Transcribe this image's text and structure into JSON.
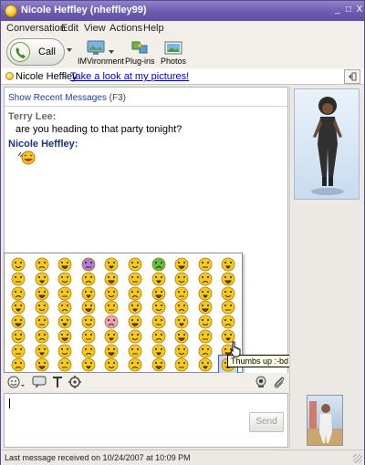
{
  "window": {
    "title": "Nicole Heffley (nheffley99)",
    "controls": [
      "_",
      "□",
      "X"
    ]
  },
  "menu": [
    "Conversation",
    "Edit",
    "View",
    "Actions",
    "Help"
  ],
  "toolbar": {
    "call_label": "Call",
    "tools": [
      {
        "label": "IMVironment",
        "icon": "imvironment-icon"
      },
      {
        "label": "Plug-ins",
        "icon": "plugins-icon"
      },
      {
        "label": "Photos",
        "icon": "photos-icon"
      }
    ]
  },
  "status": {
    "name": "Nicole Heffley",
    "separator": "-",
    "link": "Take a look at my pictures!"
  },
  "chat": {
    "show_recent": "Show Recent Messages",
    "show_recent_key": "(F3)",
    "messages": [
      {
        "sender": "Terry Lee:",
        "text": "are you heading to that party tonight?"
      },
      {
        "sender": "Nicole Heffley:",
        "emoticon": "laughing-wave-emoticon"
      }
    ]
  },
  "emoticons": {
    "tooltip": "Thumbs up   :-bd",
    "hovered_index": 79,
    "columns": 10,
    "rows": 8
  },
  "composer": {
    "value": "",
    "send_label": "Send"
  },
  "footer": {
    "status_text": "Last message received on 10/24/2007 at 10:09 PM"
  },
  "colors": {
    "titlebar": "#6b5cb0",
    "link": "#0000cc",
    "sender_self": "#1c2f8f",
    "sender_other": "#6b6b6b",
    "emoticon_yellow": "#f7c91d"
  }
}
